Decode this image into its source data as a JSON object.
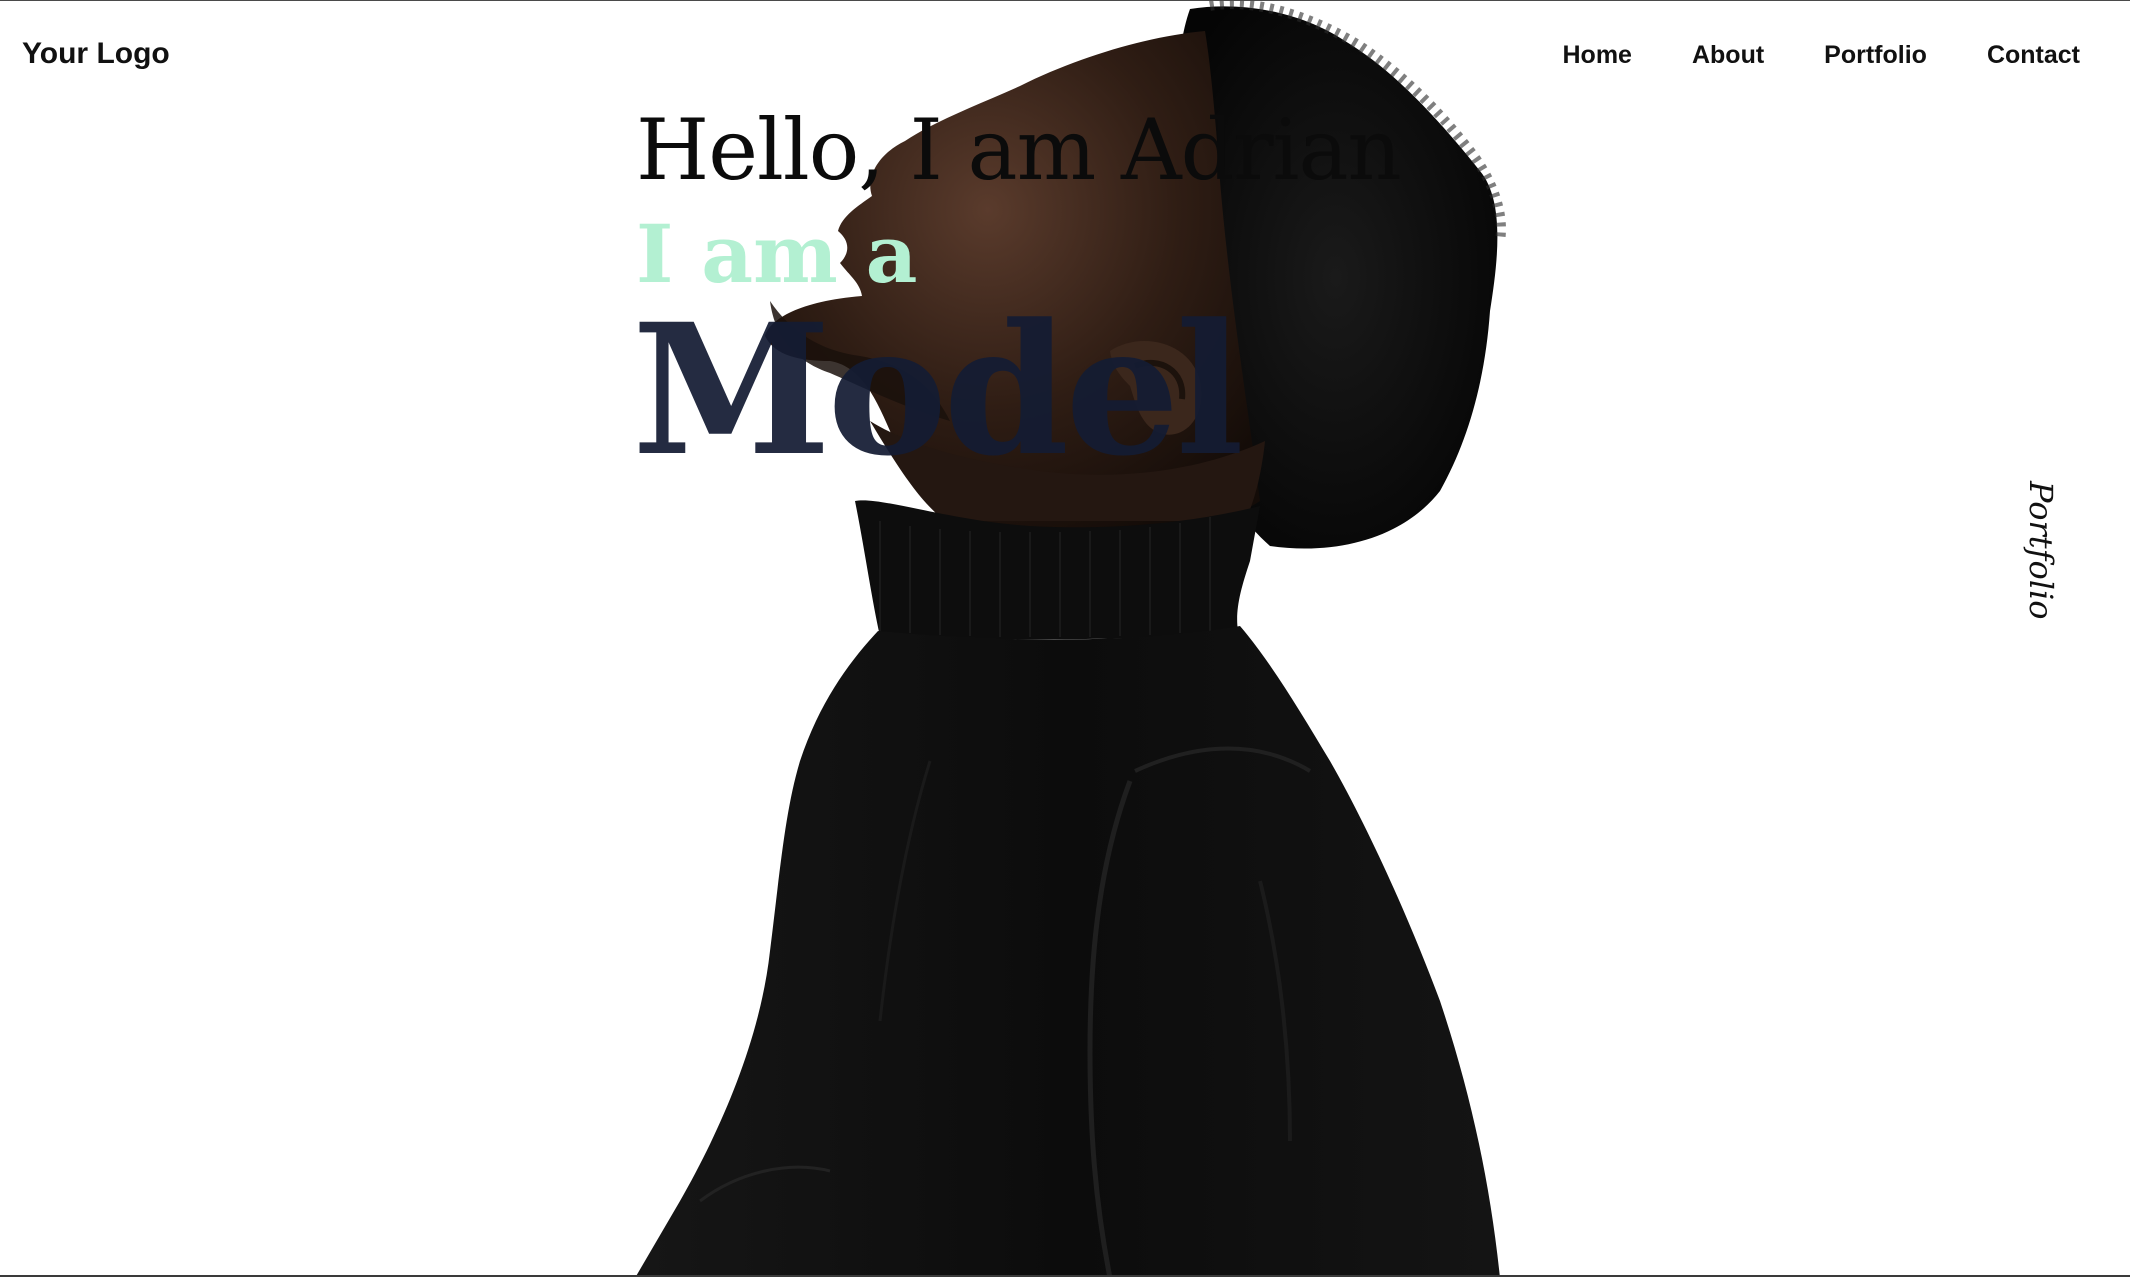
{
  "header": {
    "logo": "Your Logo",
    "nav": [
      "Home",
      "About",
      "Portfolio",
      "Contact"
    ]
  },
  "hero": {
    "greeting": "Hello, I am Adrian",
    "intro": "I am a",
    "role": "Model"
  },
  "side_link": "Portfolio",
  "colors": {
    "accent": "#b3f0d2",
    "heading": "#141c33",
    "text": "#111111",
    "background": "#ffffff"
  }
}
